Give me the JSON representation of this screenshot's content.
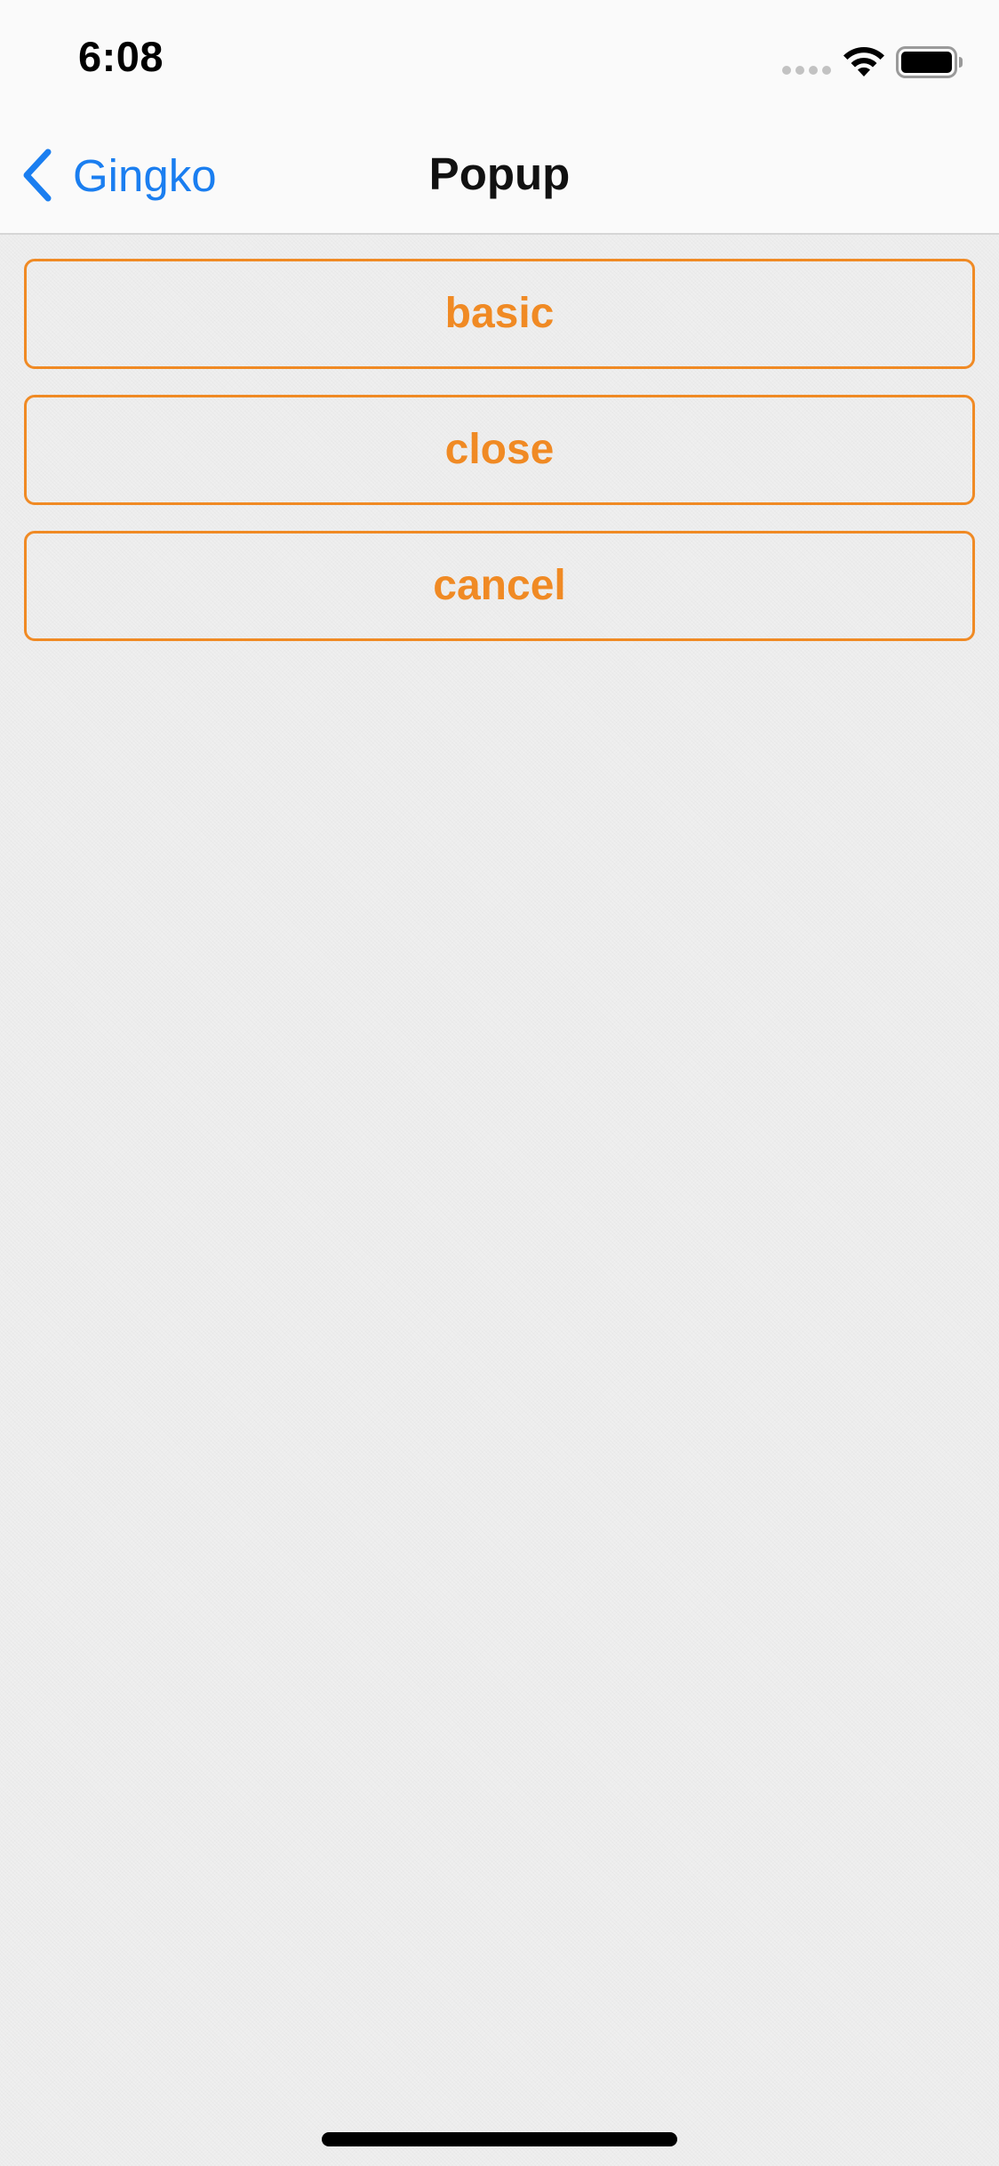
{
  "status_bar": {
    "time": "6:08",
    "signal_icon": "cellular-signal-dots-icon",
    "wifi_icon": "wifi-icon",
    "battery_icon": "battery-full-icon",
    "battery_level": 1.0
  },
  "nav_bar": {
    "back_icon": "chevron-back-icon",
    "back_label": "Gingko",
    "title": "Popup"
  },
  "actions": [
    {
      "label": "basic"
    },
    {
      "label": "close"
    },
    {
      "label": "cancel"
    }
  ],
  "colors": {
    "accent": "#f08a24",
    "link": "#1a7ef0",
    "background": "#efefef",
    "bar": "#fafafa"
  }
}
